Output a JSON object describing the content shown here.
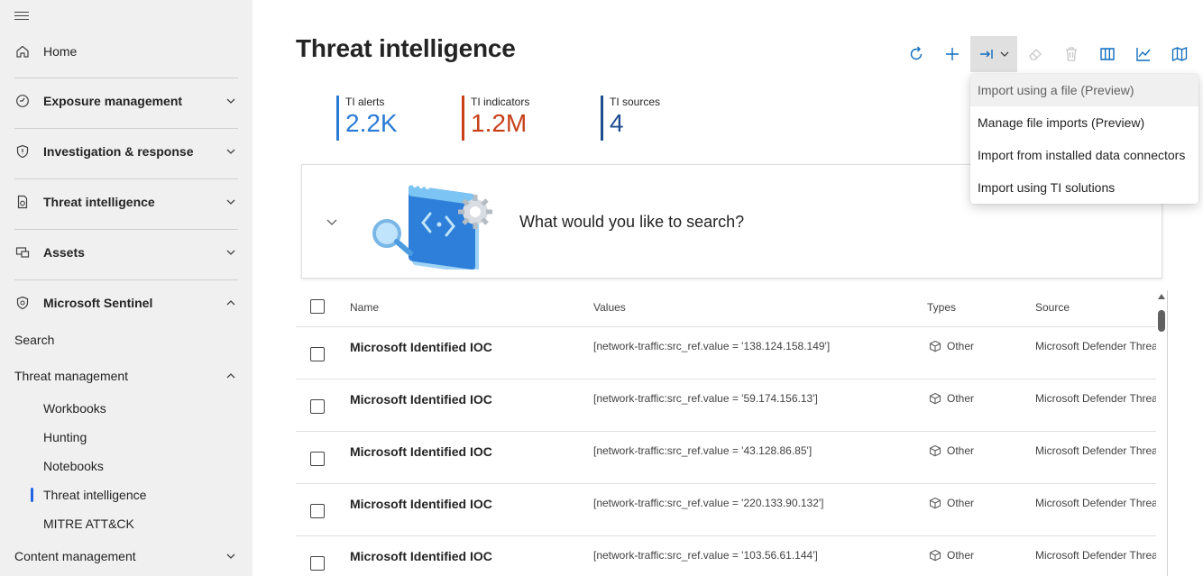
{
  "sidebar": {
    "items": [
      {
        "label": "Home"
      },
      {
        "label": "Exposure management"
      },
      {
        "label": "Investigation & response"
      },
      {
        "label": "Threat intelligence"
      },
      {
        "label": "Assets"
      },
      {
        "label": "Microsoft Sentinel"
      }
    ],
    "search_label": "Search",
    "threat_management": {
      "label": "Threat management",
      "children": [
        "Workbooks",
        "Hunting",
        "Notebooks",
        "Threat intelligence",
        "MITRE ATT&CK"
      ],
      "selected": "Threat intelligence"
    },
    "content_management": "Content management"
  },
  "page": {
    "title": "Threat intelligence"
  },
  "stats": [
    {
      "label": "TI alerts",
      "value": "2.2K",
      "color": "#2b7bd6"
    },
    {
      "label": "TI indicators",
      "value": "1.2M",
      "color": "#c8401a"
    },
    {
      "label": "TI sources",
      "value": "4",
      "color": "#1f4e8f"
    }
  ],
  "search": {
    "prompt": "What would you like to search?"
  },
  "table": {
    "headers": {
      "name": "Name",
      "values": "Values",
      "types": "Types",
      "source": "Source"
    },
    "rows": [
      {
        "name": "Microsoft Identified IOC",
        "value": "[network-traffic:src_ref.value = '138.124.158.149']",
        "type": "Other",
        "source": "Microsoft Defender Threat Intelligence"
      },
      {
        "name": "Microsoft Identified IOC",
        "value": "[network-traffic:src_ref.value = '59.174.156.13']",
        "type": "Other",
        "source": "Microsoft Defender Threat Intelligence"
      },
      {
        "name": "Microsoft Identified IOC",
        "value": "[network-traffic:src_ref.value = '43.128.86.85']",
        "type": "Other",
        "source": "Microsoft Defender Threat Intelligence"
      },
      {
        "name": "Microsoft Identified IOC",
        "value": "[network-traffic:src_ref.value = '220.133.90.132']",
        "type": "Other",
        "source": "Microsoft Defender Threat Intelligence"
      },
      {
        "name": "Microsoft Identified IOC",
        "value": "[network-traffic:src_ref.value = '103.56.61.144']",
        "type": "Other",
        "source": "Microsoft Defender Threat Intelligence"
      }
    ]
  },
  "import_menu": {
    "items": [
      "Import using a file (Preview)",
      "Manage file imports (Preview)",
      "Import from installed data connectors",
      "Import using TI solutions"
    ],
    "hovered": "Import using a file (Preview)"
  },
  "colors": {
    "accent": "#0f6cbd",
    "sidebar_bg": "#f0f0f0"
  }
}
